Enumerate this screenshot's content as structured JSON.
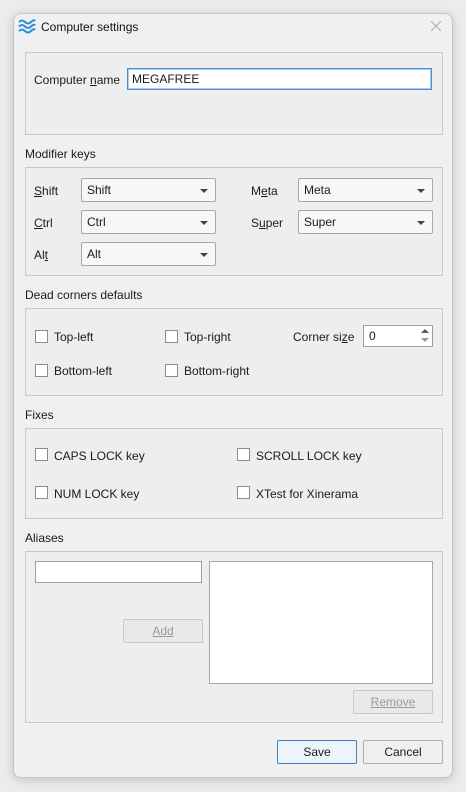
{
  "window": {
    "title": "Computer settings",
    "icon": "wave-logo-icon",
    "accent_color": "#2a8fd6"
  },
  "general": {
    "name_label": "Computer name",
    "name_value": "MEGAFREE"
  },
  "modifiers": {
    "title": "Modifier keys",
    "shift_label": "Shift",
    "shift_value": "Shift",
    "ctrl_label": "Ctrl",
    "ctrl_value": "Ctrl",
    "alt_label": "Alt",
    "alt_value": "Alt",
    "meta_label": "Meta",
    "meta_value": "Meta",
    "super_label": "Super",
    "super_value": "Super"
  },
  "dead_corners": {
    "title": "Dead corners defaults",
    "top_left": "Top-left",
    "top_right": "Top-right",
    "bottom_left": "Bottom-left",
    "bottom_right": "Bottom-right",
    "corner_size_label": "Corner size",
    "corner_size_value": "0"
  },
  "fixes": {
    "title": "Fixes",
    "caps_lock": "CAPS LOCK key",
    "scroll_lock": "SCROLL LOCK key",
    "num_lock": "NUM LOCK key",
    "xtest": "XTest for Xinerama"
  },
  "aliases": {
    "title": "Aliases",
    "input_value": "",
    "add_label": "Add",
    "remove_label": "Remove"
  },
  "footer": {
    "save_label": "Save",
    "cancel_label": "Cancel"
  }
}
